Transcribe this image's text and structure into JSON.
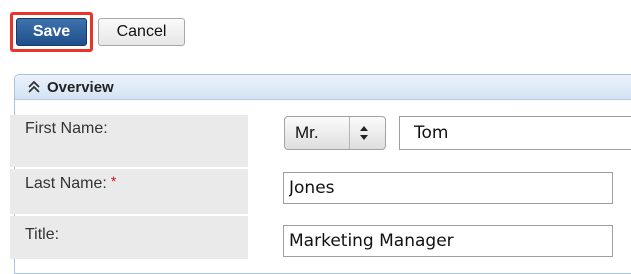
{
  "toolbar": {
    "save_label": "Save",
    "cancel_label": "Cancel"
  },
  "panel": {
    "title": "Overview",
    "collapse_icon": "double-chevron-up-icon"
  },
  "fields": {
    "first_name": {
      "label": "First Name:",
      "salutation": "Mr.",
      "value": "Tom"
    },
    "last_name": {
      "label": "Last Name:",
      "required_marker": "*",
      "value": "Jones"
    },
    "title": {
      "label": "Title:",
      "value": "Marketing Manager"
    }
  },
  "colors": {
    "save_button": "#2a5d99",
    "highlight": "#e8342a",
    "label_bg": "#eaeaea",
    "panel_header": "#dce8f5",
    "required": "#d01010"
  }
}
